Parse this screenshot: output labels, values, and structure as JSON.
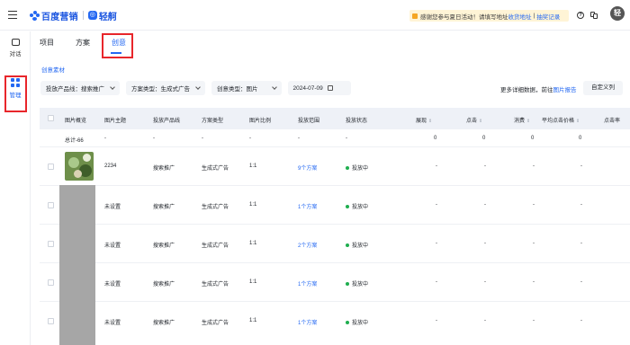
{
  "brand": {
    "name": "百度营销",
    "product": "轻舸"
  },
  "notice": {
    "text": "感谢您参与夏日活动！请填写地址",
    "link1": "收货地址",
    "sep": "|",
    "link2": "抽奖记录"
  },
  "avatar_letter": "轻",
  "rail": {
    "chat_label": "对话",
    "manage_label": "管理"
  },
  "tabs": [
    {
      "label": "项目"
    },
    {
      "label": "方案"
    },
    {
      "label": "创意"
    }
  ],
  "section_label": "创意素材",
  "filters": [
    {
      "label": "投放产品线：搜索推广"
    },
    {
      "label": "方案类型：生成式广告"
    },
    {
      "label": "创意类型：图片"
    },
    {
      "label": "2024-07-09"
    }
  ],
  "more": {
    "text": "更多详细数据，前往",
    "link": "图片报告"
  },
  "custom_columns_label": "自定义列",
  "columns": [
    "图片概览",
    "图片主题",
    "投放产品线",
    "方案类型",
    "图片比例",
    "投放范围",
    "投放状态",
    "展现",
    "点击",
    "消费",
    "平均点击价格",
    "点击率"
  ],
  "total_row": [
    "总计-66",
    "-",
    "-",
    "-",
    "-",
    "-",
    "-",
    "0",
    "0",
    "0",
    "0"
  ],
  "rows": [
    {
      "theme": "2234",
      "product": "搜索推广",
      "plan_type": "生成式广告",
      "ratio": "1:1",
      "scope": "9个方案",
      "status": "投放中",
      "impressions": "-",
      "clicks": "-",
      "cost": "-",
      "avg_cpc": "-"
    },
    {
      "theme": "未设置",
      "product": "搜索推广",
      "plan_type": "生成式广告",
      "ratio": "1:1",
      "scope": "1个方案",
      "status": "投放中",
      "impressions": "-",
      "clicks": "-",
      "cost": "-",
      "avg_cpc": "-"
    },
    {
      "theme": "未设置",
      "product": "搜索推广",
      "plan_type": "生成式广告",
      "ratio": "1:1",
      "scope": "2个方案",
      "status": "投放中",
      "impressions": "-",
      "clicks": "-",
      "cost": "-",
      "avg_cpc": "-"
    },
    {
      "theme": "未设置",
      "product": "搜索推广",
      "plan_type": "生成式广告",
      "ratio": "1:1",
      "scope": "1个方案",
      "status": "投放中",
      "impressions": "-",
      "clicks": "-",
      "cost": "-",
      "avg_cpc": "-"
    },
    {
      "theme": "未设置",
      "product": "搜索推广",
      "plan_type": "生成式广告",
      "ratio": "1:1",
      "scope": "1个方案",
      "status": "投放中",
      "impressions": "-",
      "clicks": "-",
      "cost": "-",
      "avg_cpc": "-"
    }
  ],
  "colors": {
    "accent": "#2468f2",
    "highlight": "#e8262b",
    "status_green": "#1fae4f"
  }
}
